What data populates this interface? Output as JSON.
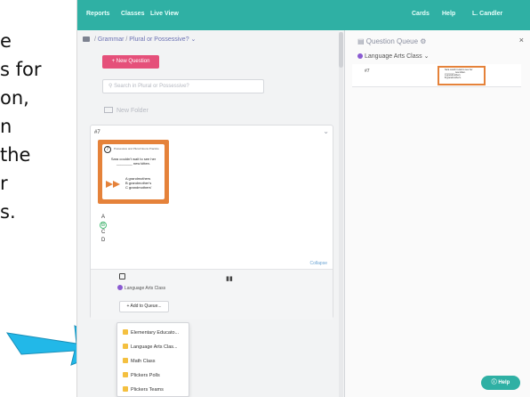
{
  "slide_text": [
    "e",
    "s for",
    "on,",
    "n",
    "the",
    "r",
    "s."
  ],
  "topbar": {
    "reports": "Reports",
    "classes": "Classes",
    "live_view": "Live View",
    "cards": "Cards",
    "help": "Help",
    "user": "L. Candler"
  },
  "breadcrumb": {
    "root": "Grammar",
    "folder": "Plural or Possessive?",
    "separator": "/",
    "chevron": "chevron-down-icon"
  },
  "new_question": "+ New Question",
  "search": {
    "placeholder": "Search in Plural or Possessive?"
  },
  "new_folder": "New Folder",
  "question_card": {
    "number": "#7",
    "image": {
      "badge": "7",
      "title": "Possessive and Plural Nouns Practice",
      "question": "Sara couldn't wait to see her ________ new kitten.",
      "answers": [
        "A  grandmothers",
        "B  grandmother's",
        "C  grandmothers'"
      ]
    },
    "choices": [
      "A",
      "B",
      "C",
      "D"
    ],
    "correct_choice": "B",
    "collapse": "Collapse",
    "class_name": "Language Arts Class",
    "add_to_queue": "+ Add to Queue..."
  },
  "queue_dropdown": {
    "items": [
      "Elementary Educato...",
      "Language Arts Clas...",
      "Math Class",
      "Plickers Polls",
      "Plickers Teams"
    ],
    "item_color": "#f4c040"
  },
  "question_queue": {
    "title": "Question Queue",
    "close": "×",
    "class_name": "Language Arts Class",
    "item_number": "#7",
    "item_preview": [
      "Sara couldn't wait to see her",
      "________ new kitten.",
      "A  grandmothers",
      "B  grandmother's"
    ]
  },
  "help_button": "Help",
  "colors": {
    "topbar": "#2fb0a4",
    "new_question": "#e5507a",
    "class_dot": "#8a5ad1",
    "card_frame": "#e5823a",
    "arrow": "#22b8e8"
  }
}
